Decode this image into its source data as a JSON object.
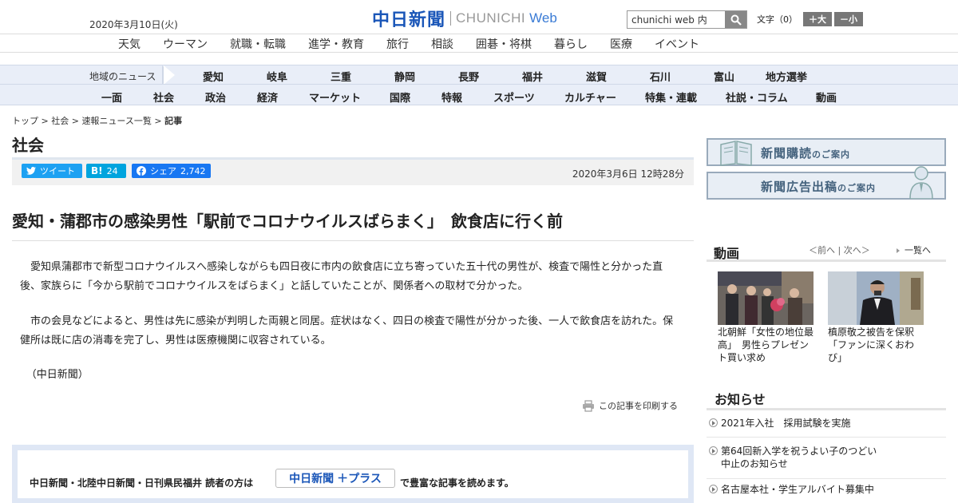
{
  "header": {
    "date": "2020年3月10日(火)",
    "logo_kanji": "中日新聞",
    "logo_en": "CHUNICHI",
    "logo_web": "Web",
    "search_value": "chunichi web 内",
    "fontsize_label": "文字（0）",
    "fontsize_up": "＋大",
    "fontsize_down": "－小"
  },
  "nav_top": [
    "天気",
    "ウーマン",
    "就職・転職",
    "進学・教育",
    "旅行",
    "相談",
    "囲碁・将棋",
    "暮らし",
    "医療",
    "イベント"
  ],
  "nav_region": {
    "label": "地域のニュース",
    "items": [
      "愛知",
      "岐阜",
      "三重",
      "静岡",
      "長野",
      "福井",
      "滋賀",
      "石川",
      "富山",
      "地方選挙"
    ]
  },
  "nav_category": [
    "一面",
    "社会",
    "政治",
    "経済",
    "マーケット",
    "国際",
    "特報",
    "スポーツ",
    "カルチャー",
    "特集・連載",
    "社説・コラム",
    "動画"
  ],
  "breadcrumb": {
    "items": [
      "トップ",
      "社会",
      "速報ニュース一覧"
    ],
    "current": "記事",
    "sep": " > "
  },
  "section": {
    "title": "社会"
  },
  "share": {
    "tweet": "ツイート",
    "hatena_label": "B!",
    "hatena_count": "24",
    "fb_label": "シェア",
    "fb_count": "2,742",
    "published": "2020年3月6日 12時28分"
  },
  "article": {
    "headline": "愛知・蒲郡市の感染男性「駅前でコロナウイルスばらまく」　飲食店に行く前",
    "paragraphs": [
      "愛知県蒲郡市で新型コロナウイルスへ感染しながらも四日夜に市内の飲食店に立ち寄っていた五十代の男性が、検査で陽性と分かった直後、家族らに「今から駅前でコロナウイルスをばらまく」と話していたことが、関係者への取材で分かった。",
      "市の会見などによると、男性は先に感染が判明した両親と同居。症状はなく、四日の検査で陽性が分かった後、一人で飲食店を訪れた。保健所は既に店の消毒を完了し、男性は医療機関に収容されている。"
    ],
    "credit": "（中日新聞）",
    "print_label": "この記事を印刷する"
  },
  "plus_banner": {
    "text_before": "中日新聞・北陸中日新聞・日刊県民福井 読者の方は",
    "logo_text": "中日新聞",
    "logo_plus": "＋プラス",
    "text_after": "で豊富な記事を読めます。"
  },
  "sidebar": {
    "banner1_main": "新聞購読",
    "banner1_sub": "のご案内",
    "banner2_main": "新聞広告出稿",
    "banner2_sub": "のご案内",
    "video_title": "動画",
    "video_prev": "＜前へ",
    "video_next": "次へ＞",
    "video_all": "一覧へ",
    "videos": [
      {
        "caption": "北朝鮮「女性の地位最高」　男性らプレゼント買い求め"
      },
      {
        "caption": "槙原敬之被告を保釈「ファンに深くおわび」"
      }
    ],
    "news_title": "お知らせ",
    "news": [
      "2021年入社　採用試験を実施",
      "第64回新入学を祝うよい子のつどい　中止のお知らせ",
      "名古屋本社・学生アルバイト募集中"
    ]
  },
  "colors": {
    "brand_blue": "#1a56b8",
    "twitter": "#1da1f2",
    "hatena": "#00a4de",
    "facebook": "#1877f2"
  }
}
